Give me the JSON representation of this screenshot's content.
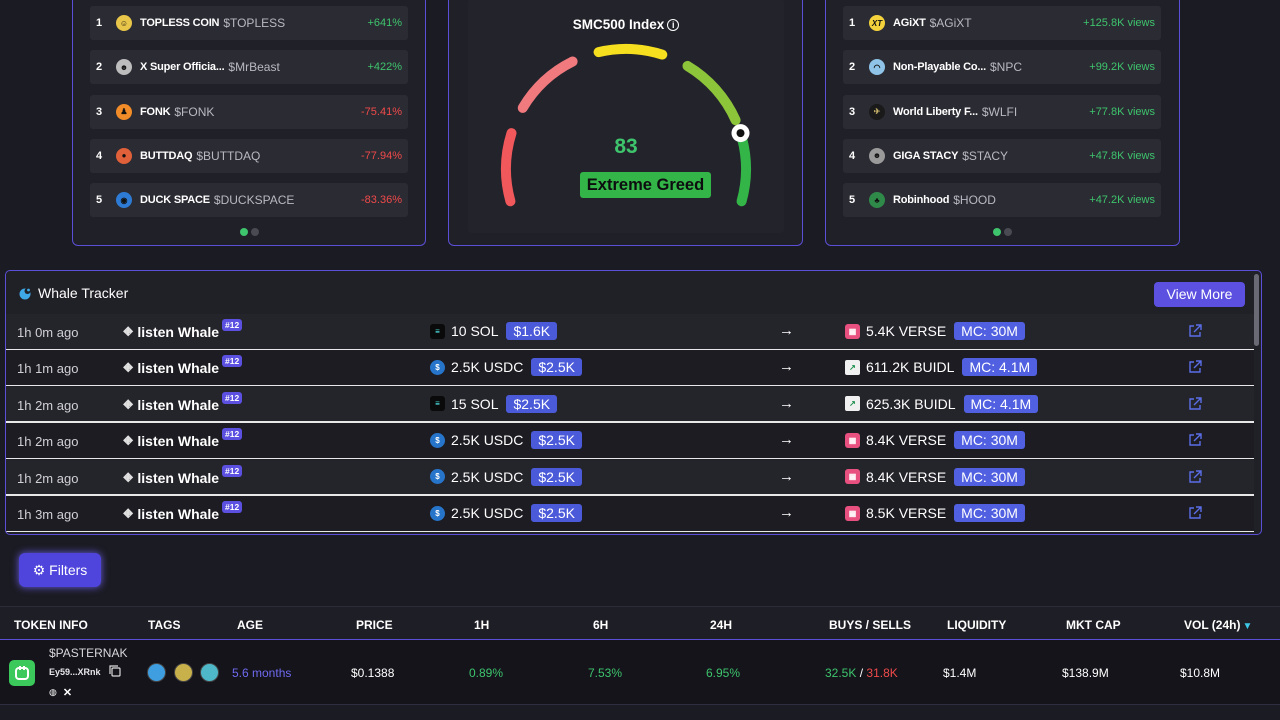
{
  "left_card": {
    "items": [
      {
        "rank": "1",
        "name": "TOPLESS COIN",
        "symbol": "$TOPLESS",
        "change": "+641%",
        "dir": "pos",
        "icon_color": "#e8c64a"
      },
      {
        "rank": "2",
        "name": "X Super Officia...",
        "symbol": "$MrBeast",
        "change": "+422%",
        "dir": "pos",
        "icon_color": "#bdbdbd"
      },
      {
        "rank": "3",
        "name": "FONK",
        "symbol": "$FONK",
        "change": "-75.41%",
        "dir": "neg",
        "icon_color": "#f28c28"
      },
      {
        "rank": "4",
        "name": "BUTTDAQ",
        "symbol": "$BUTTDAQ",
        "change": "-77.94%",
        "dir": "neg",
        "icon_color": "#e0603a"
      },
      {
        "rank": "5",
        "name": "DUCK SPACE",
        "symbol": "$DUCKSPACE",
        "change": "-83.36%",
        "dir": "neg",
        "icon_color": "#2e7bd6"
      }
    ]
  },
  "gauge": {
    "title": "SMC500 Index",
    "info_icon": "info-circle-icon",
    "value": "83",
    "label": "Extreme Greed",
    "fraction": 0.83
  },
  "right_card": {
    "items": [
      {
        "rank": "1",
        "name": "AGiXT",
        "symbol": "$AGiXT",
        "change": "+125.8K views",
        "icon_text": "XT",
        "icon_color": "#f3d23c"
      },
      {
        "rank": "2",
        "name": "Non-Playable Co...",
        "symbol": "$NPC",
        "change": "+99.2K views",
        "icon_color": "#8fc3e8"
      },
      {
        "rank": "3",
        "name": "World Liberty F...",
        "symbol": "$WLFI",
        "change": "+77.8K views",
        "icon_color": "#1a1a1a"
      },
      {
        "rank": "4",
        "name": "GIGA STACY",
        "symbol": "$STACY",
        "change": "+47.8K views",
        "icon_color": "#9a9a9a"
      },
      {
        "rank": "5",
        "name": "Robinhood",
        "symbol": "$HOOD",
        "change": "+47.2K views",
        "icon_color": "#2f8a4a"
      }
    ]
  },
  "whale": {
    "title": "Whale Tracker",
    "view_more": "View More",
    "arrow": "→",
    "rows": [
      {
        "time": "1h 0m ago",
        "name": "listen Whale",
        "badge": "#12",
        "from_amount": "10 SOL",
        "from_coin": "sol",
        "from_value": "$1.6K",
        "to_amount": "5.4K VERSE",
        "to_coin": "verse",
        "mc": "MC: 30M"
      },
      {
        "time": "1h 1m ago",
        "name": "listen Whale",
        "badge": "#12",
        "from_amount": "2.5K USDC",
        "from_coin": "usdc",
        "from_value": "$2.5K",
        "to_amount": "611.2K BUIDL",
        "to_coin": "buidl",
        "mc": "MC: 4.1M"
      },
      {
        "time": "1h 2m ago",
        "name": "listen Whale",
        "badge": "#12",
        "from_amount": "15 SOL",
        "from_coin": "sol",
        "from_value": "$2.5K",
        "to_amount": "625.3K BUIDL",
        "to_coin": "buidl",
        "mc": "MC: 4.1M"
      },
      {
        "time": "1h 2m ago",
        "name": "listen Whale",
        "badge": "#12",
        "from_amount": "2.5K USDC",
        "from_coin": "usdc",
        "from_value": "$2.5K",
        "to_amount": "8.4K VERSE",
        "to_coin": "verse",
        "mc": "MC: 30M"
      },
      {
        "time": "1h 2m ago",
        "name": "listen Whale",
        "badge": "#12",
        "from_amount": "2.5K USDC",
        "from_coin": "usdc",
        "from_value": "$2.5K",
        "to_amount": "8.4K VERSE",
        "to_coin": "verse",
        "mc": "MC: 30M"
      },
      {
        "time": "1h 3m ago",
        "name": "listen Whale",
        "badge": "#12",
        "from_amount": "2.5K USDC",
        "from_coin": "usdc",
        "from_value": "$2.5K",
        "to_amount": "8.5K VERSE",
        "to_coin": "verse",
        "mc": "MC: 30M"
      }
    ]
  },
  "filters": {
    "label": "Filters",
    "icon": "gear-icon"
  },
  "table": {
    "headers": {
      "token_info": "TOKEN INFO",
      "tags": "TAGS",
      "age": "AGE",
      "price": "PRICE",
      "h1": "1H",
      "h6": "6H",
      "h24": "24H",
      "buys_sells": "BUYS / SELLS",
      "liquidity": "LIQUIDITY",
      "mkt_cap": "MKT CAP",
      "vol": "VOL (24h)"
    },
    "sort_icon": "caret-down-icon",
    "row": {
      "name": "$PASTERNAK",
      "address": "Ey59...XRnk",
      "age": "5.6 months",
      "price": "$0.1388",
      "h1": "0.89%",
      "h6": "7.53%",
      "h24": "6.95%",
      "buys": "32.5K",
      "sells": "31.8K",
      "sep": "/",
      "liquidity": "$1.4M",
      "mkt_cap": "$138.9M",
      "vol": "$10.8M"
    }
  }
}
